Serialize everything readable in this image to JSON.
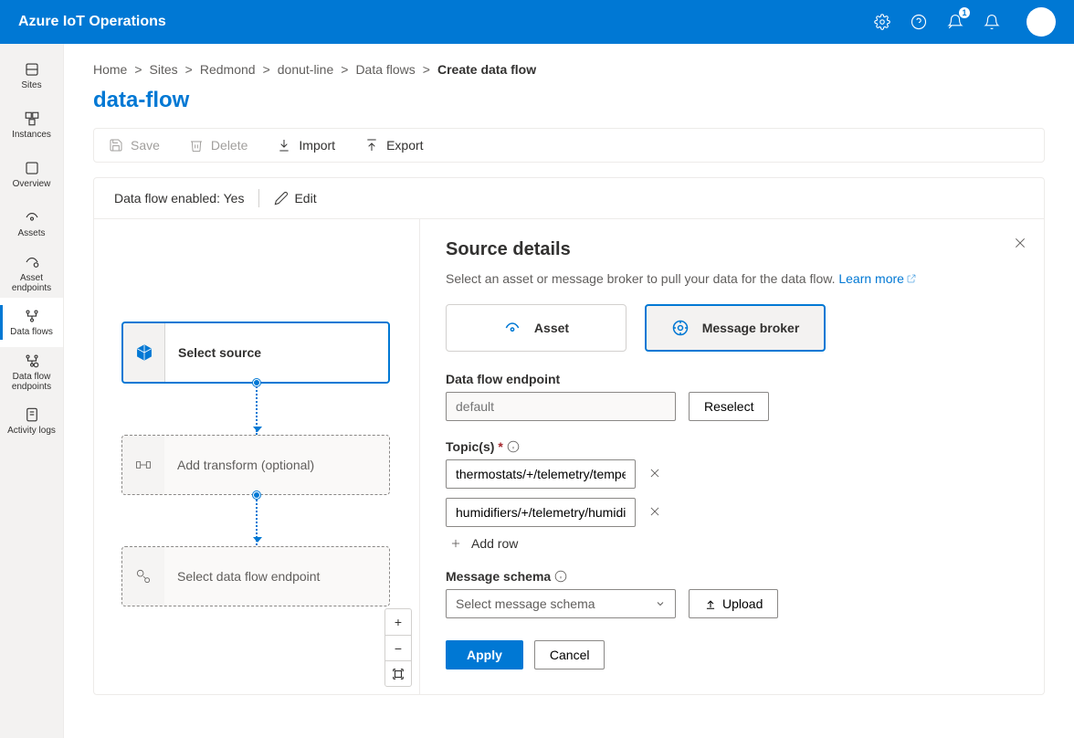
{
  "header": {
    "product": "Azure IoT Operations",
    "feedback_badge": "1"
  },
  "sidebar": {
    "items": [
      {
        "label": "Sites"
      },
      {
        "label": "Instances"
      },
      {
        "label": "Overview"
      },
      {
        "label": "Assets"
      },
      {
        "label": "Asset endpoints"
      },
      {
        "label": "Data flows"
      },
      {
        "label": "Data flow endpoints"
      },
      {
        "label": "Activity logs"
      }
    ],
    "active_index": 5
  },
  "breadcrumb": {
    "items": [
      "Home",
      "Sites",
      "Redmond",
      "donut-line",
      "Data flows",
      "Create data flow"
    ]
  },
  "page": {
    "title": "data-flow"
  },
  "toolbar": {
    "save": "Save",
    "delete": "Delete",
    "import": "Import",
    "export": "Export"
  },
  "flow_bar": {
    "enabled_label": "Data flow enabled: ",
    "enabled_value": "Yes",
    "edit": "Edit"
  },
  "canvas": {
    "nodes": {
      "source": "Select source",
      "transform": "Add transform (optional)",
      "destination": "Select data flow endpoint"
    }
  },
  "details": {
    "title": "Source details",
    "description": "Select an asset or message broker to pull your data for the data flow. ",
    "learn_more": "Learn more",
    "source_types": {
      "asset": "Asset",
      "broker": "Message broker"
    },
    "selected_source_type": "broker",
    "endpoint": {
      "label": "Data flow endpoint",
      "value": "",
      "placeholder": "default",
      "reselect": "Reselect"
    },
    "topics": {
      "label": "Topic(s)",
      "rows": [
        "thermostats/+/telemetry/temperature",
        "humidifiers/+/telemetry/humidity"
      ],
      "add_row": "Add row"
    },
    "schema": {
      "label": "Message schema",
      "placeholder": "Select message schema",
      "upload": "Upload"
    },
    "actions": {
      "apply": "Apply",
      "cancel": "Cancel"
    }
  }
}
